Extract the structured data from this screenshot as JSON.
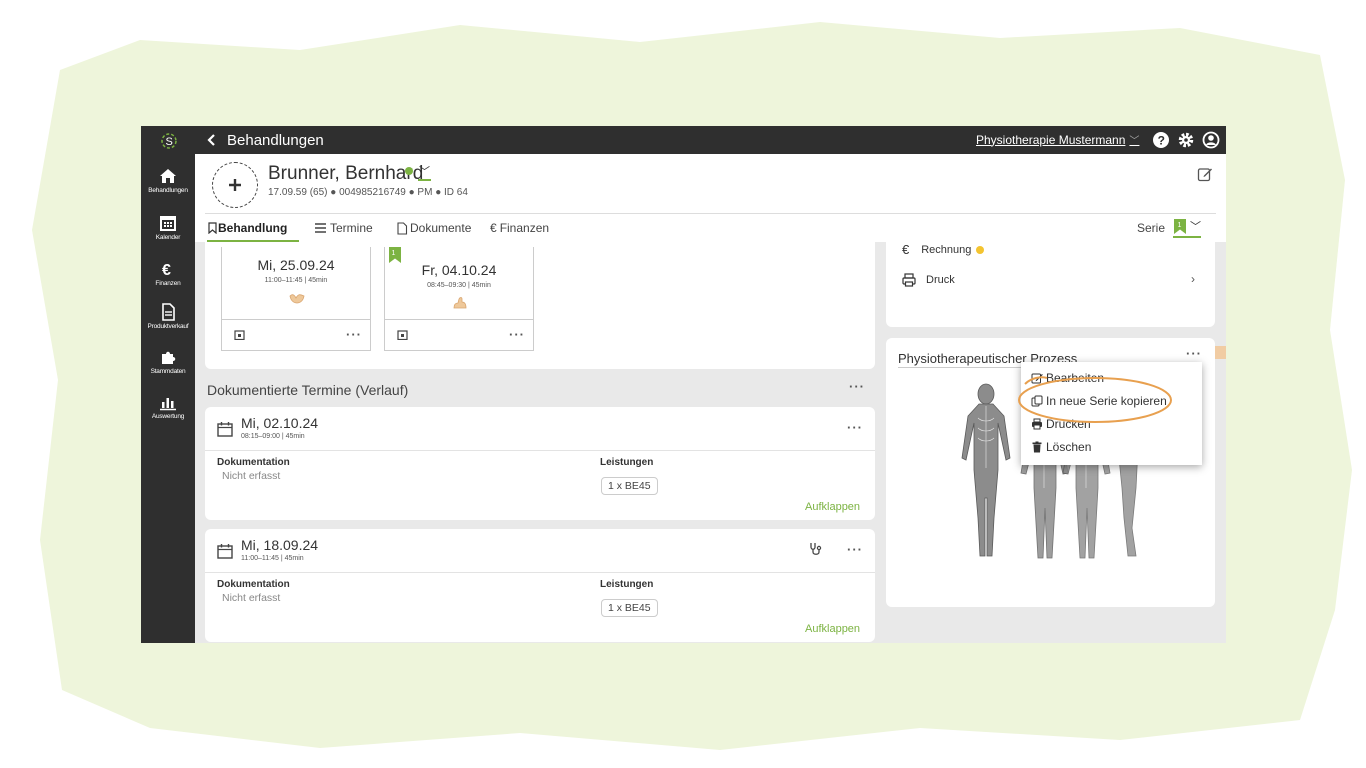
{
  "colors": {
    "accent": "#7cb342",
    "dark_bar": "#2f2f2f",
    "annotation": "#e8a04f",
    "backdrop_green": "#eef5db"
  },
  "sidebar": {
    "logo_letter": "S",
    "items": [
      {
        "label": "Behandlungen",
        "icon": "home-icon"
      },
      {
        "label": "Kalender",
        "icon": "calendar-icon"
      },
      {
        "label": "Finanzen",
        "icon": "euro-icon"
      },
      {
        "label": "Produktverkauf",
        "icon": "document-icon"
      },
      {
        "label": "Stammdaten",
        "icon": "puzzle-icon"
      },
      {
        "label": "Auswertung",
        "icon": "chart-icon"
      }
    ]
  },
  "topbar": {
    "title": "Behandlungen",
    "practice": "Physiotherapie Mustermann"
  },
  "patient": {
    "name": "Brunner, Bernhard",
    "meta": "17.09.59 (65) ● 004985216749 ● PM ● ID 64"
  },
  "tabs": [
    {
      "label": "Behandlung",
      "icon": "bookmark-icon"
    },
    {
      "label": "Termine",
      "icon": "list-icon"
    },
    {
      "label": "Dokumente",
      "icon": "document-icon"
    },
    {
      "label": "Finanzen",
      "icon": "euro-icon"
    }
  ],
  "serie_label": "Serie",
  "upcoming": [
    {
      "date": "Mi, 25.09.24",
      "time": "11:00–11:45 | 45min"
    },
    {
      "date": "Fr, 04.10.24",
      "time": "08:45–09:30 | 45min",
      "bookmark": "1"
    }
  ],
  "history": {
    "title": "Dokumentierte Termine (Verlauf)",
    "entries": [
      {
        "date": "Mi, 02.10.24",
        "time": "08:15–09:00 | 45min",
        "doc_label": "Dokumentation",
        "doc_value": "Nicht erfasst",
        "svc_label": "Leistungen",
        "svc_value": "1 x BE45",
        "expand": "Aufklappen"
      },
      {
        "date": "Mi, 18.09.24",
        "time": "11:00–11:45 | 45min",
        "doc_label": "Dokumentation",
        "doc_value": "Nicht erfasst",
        "svc_label": "Leistungen",
        "svc_value": "1 x BE45",
        "expand": "Aufklappen"
      }
    ]
  },
  "right": {
    "rechnung": "Rechnung",
    "druck": "Druck",
    "process_title": "Physiotherapeutischer Prozess"
  },
  "menu": {
    "items": [
      {
        "label": "Bearbeiten",
        "icon": "edit-icon"
      },
      {
        "label": "In neue Serie kopieren",
        "icon": "copy-icon"
      },
      {
        "label": "Drucken",
        "icon": "print-icon"
      },
      {
        "label": "Löschen",
        "icon": "trash-icon"
      }
    ]
  }
}
